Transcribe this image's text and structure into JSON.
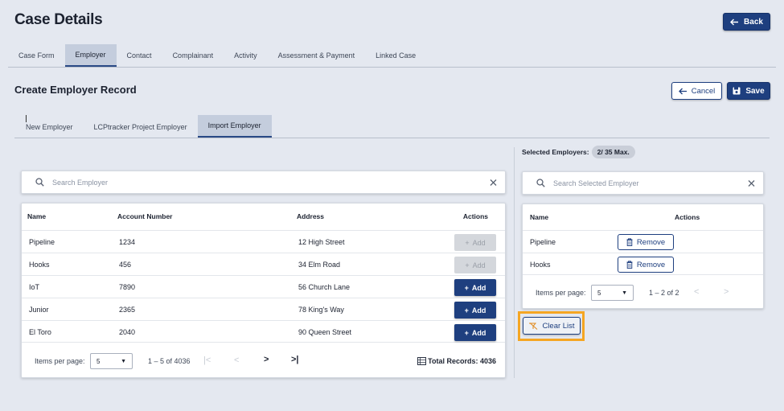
{
  "header": {
    "title": "Case Details",
    "back_label": "Back"
  },
  "main_tabs": [
    {
      "label": "Case Form"
    },
    {
      "label": "Employer"
    },
    {
      "label": "Contact"
    },
    {
      "label": "Complainant"
    },
    {
      "label": "Activity"
    },
    {
      "label": "Assessment & Payment"
    },
    {
      "label": "Linked Case"
    }
  ],
  "active_main_tab": "Employer",
  "section": {
    "title": "Create Employer Record",
    "cancel_label": "Cancel",
    "save_label": "Save"
  },
  "sub_tabs": [
    {
      "label": "New Employer"
    },
    {
      "label": "LCPtracker Project Employer"
    },
    {
      "label": "Import Employer"
    }
  ],
  "active_sub_tab": "Import Employer",
  "search": {
    "placeholder": "Search Employer"
  },
  "table": {
    "columns": {
      "name": "Name",
      "account": "Account Number",
      "address": "Address",
      "actions": "Actions"
    },
    "rows": [
      {
        "name": "Pipeline",
        "account": "1234",
        "address": "12 High Street",
        "action": "Add",
        "enabled": false
      },
      {
        "name": "Hooks",
        "account": "456",
        "address": "34 Elm Road",
        "action": "Add",
        "enabled": false
      },
      {
        "name": "IoT",
        "account": "7890",
        "address": "56 Church Lane",
        "action": "Add",
        "enabled": true
      },
      {
        "name": "Junior",
        "account": "2365",
        "address": "78 King's Way",
        "action": "Add",
        "enabled": true
      },
      {
        "name": "El Toro",
        "account": "2040",
        "address": "90 Queen Street",
        "action": "Add",
        "enabled": true
      }
    ],
    "pager": {
      "items_label": "Items per page:",
      "page_size": "5",
      "range": "1 – 5 of 4036",
      "total": "Total Records: 4036"
    }
  },
  "selected": {
    "label": "Selected Employers:",
    "count_badge": "2/ 35 Max.",
    "search_placeholder": "Search Selected Employer",
    "columns": {
      "name": "Name",
      "actions": "Actions"
    },
    "rows": [
      {
        "name": "Pipeline",
        "action": "Remove"
      },
      {
        "name": "Hooks",
        "action": "Remove"
      }
    ],
    "pager": {
      "items_label": "Items per page:",
      "page_size": "5",
      "range": "1 – 2 of 2"
    },
    "clear_label": "Clear List"
  },
  "colors": {
    "primary": "#1e3f7f",
    "background": "#e4e8f0",
    "highlight": "#f5a623",
    "disabled": "#d4d7dc"
  }
}
